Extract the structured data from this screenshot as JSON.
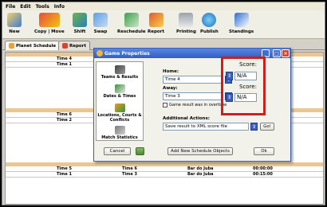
{
  "menubar": {
    "items": [
      "File",
      "Edit",
      "Tools",
      "Info"
    ]
  },
  "toolbar": {
    "items": [
      {
        "label": "New",
        "icon": "new-schedule-icon"
      },
      {
        "label": "Copy | Move",
        "icon": "copy-move-icon"
      },
      {
        "label": "Shift",
        "icon": "shift-icon"
      },
      {
        "label": "Swap",
        "icon": "swap-icon"
      },
      {
        "label": "Reschedule",
        "icon": "reschedule-icon"
      },
      {
        "label": "Report",
        "icon": "report-icon"
      },
      {
        "label": "Printing",
        "icon": "printer-icon"
      },
      {
        "label": "Publish",
        "icon": "globe-icon"
      },
      {
        "label": "Standings",
        "icon": "standings-icon"
      }
    ]
  },
  "tabs": [
    {
      "label": "Planet Schedule"
    },
    {
      "label": "Report"
    }
  ],
  "grid": {
    "rows_top": [
      {
        "team1": "Time 4"
      },
      {
        "team1": "Time 1"
      }
    ],
    "rows_mid": [
      {
        "team1": "Time 6"
      },
      {
        "team1": "Time 2"
      }
    ],
    "rows_bottom": [
      {
        "team1": "Time 5",
        "team2": "Time 6",
        "venue": "Bar do Juba",
        "time": "00:00:00"
      },
      {
        "team1": "Time 1",
        "team2": "Time 3",
        "venue": "Bar do Juba",
        "time": "00:15:00"
      }
    ]
  },
  "dialog": {
    "title": "Game Properties",
    "sidebar": [
      {
        "label": "Teams & Results",
        "icon": "teams-results-icon"
      },
      {
        "label": "Dates & Times",
        "icon": "calendar-icon"
      },
      {
        "label": "Locations, Courts & Conflicts",
        "icon": "locations-icon"
      },
      {
        "label": "Match Statistics",
        "icon": "statistics-icon"
      }
    ],
    "home_label": "Home:",
    "home_value": "Time 4",
    "away_label": "Away:",
    "away_value": "Time 3",
    "score_label_home": "Score:",
    "score_value_home": "N/A",
    "score_label_away": "Score:",
    "score_value_away": "N/A",
    "overtime_label": "Game result was in overtime",
    "additional_label": "Additional Actions:",
    "action_value": "Save result to XML score file",
    "go_label": "Go!",
    "cancel_label": "Cancel",
    "add_objects_label": "Add New Schedule Objects",
    "ok_label": "Ok"
  },
  "colors": {
    "highlight": "#cc1f1f",
    "titlebar": "#2f5fc6",
    "grid_header": "#e8c890"
  }
}
